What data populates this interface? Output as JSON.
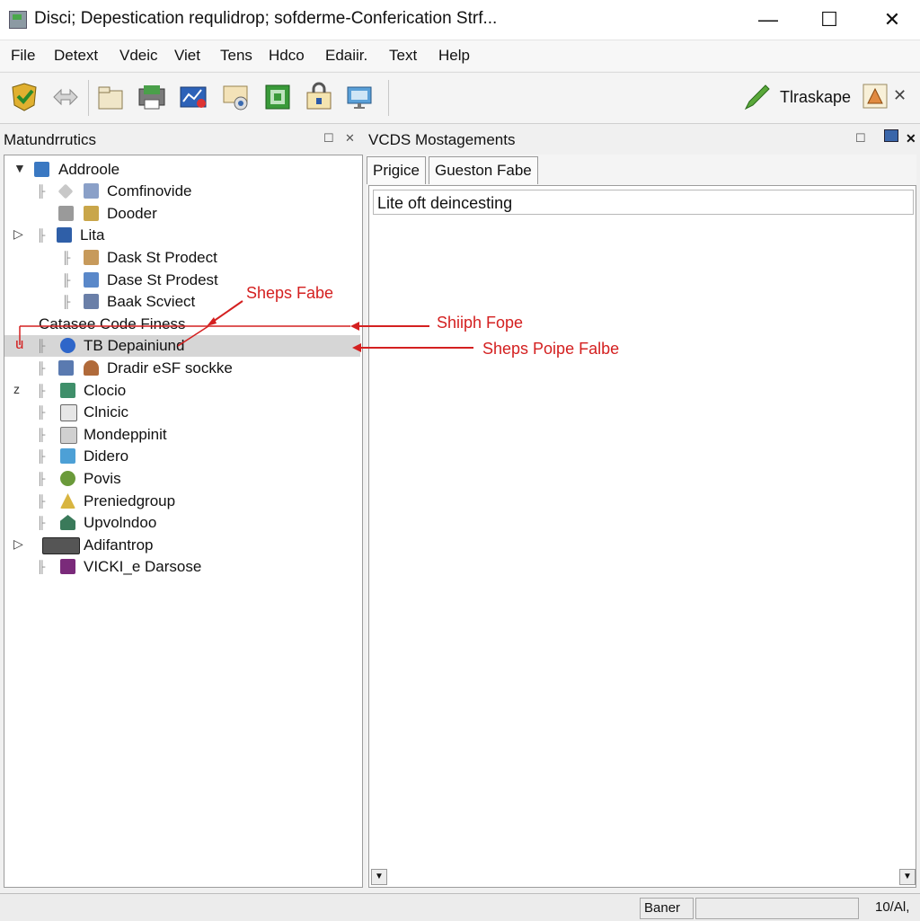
{
  "window": {
    "title": "Disci; Depestication requlidrop; sofderme-Conferication Strf...",
    "minimize_glyph": "—",
    "maximize_glyph": "☐",
    "close_glyph": "✕"
  },
  "menu": [
    "File",
    "Detext",
    "Vdeic",
    "Viet",
    "Tens",
    "Hdco",
    "Edaiir.",
    "Text",
    "Help"
  ],
  "toolbar": {
    "buttons": [
      "shield-icon",
      "arrows-icon",
      "folder-icon",
      "printer-icon",
      "chart-icon",
      "settings-icon",
      "grid-icon",
      "lock-icon",
      "monitor-icon"
    ],
    "right_label": "Tlraskape",
    "right_close_glyph": "✕"
  },
  "left_pane": {
    "title": "Matundrrutics",
    "pin_glyph": "☐",
    "close_glyph": "✕"
  },
  "right_pane": {
    "title": "VCDS Mostagements",
    "pin_glyph": "☐",
    "close_glyph": "✕"
  },
  "tabs": [
    "Prigice",
    "Gueston Fabe"
  ],
  "field_text": "Lite oft deincesting",
  "tree": [
    {
      "label": "Addroole",
      "expander": "▼",
      "icon_color": "#3a78c2",
      "selected": false
    },
    {
      "label": "Comfinovide",
      "expander": "",
      "icon_color": "#8aa0c8",
      "selected": false
    },
    {
      "label": "Dooder",
      "expander": "",
      "icon_color": "#c9a64a",
      "selected": false
    },
    {
      "label": "Lita",
      "expander": "▷",
      "icon_color": "#2f5fa8",
      "selected": false
    },
    {
      "label": "Dask St Prodect",
      "expander": "",
      "icon_color": "#c79a5b",
      "selected": false
    },
    {
      "label": "Dase St Prodest",
      "expander": "",
      "icon_color": "#5a88c9",
      "selected": false
    },
    {
      "label": "Baak Scviect",
      "expander": "",
      "icon_color": "#6a7fa8",
      "selected": false
    },
    {
      "label": "Catasee Code Finess",
      "expander": "",
      "icon_color": "",
      "selected": false
    },
    {
      "label": "TB Depainiund",
      "expander": "",
      "icon_color": "#2e66c9",
      "selected": true
    },
    {
      "label": "Dradir eSF sockke",
      "expander": "",
      "icon_color": "#b06a3a",
      "selected": false
    },
    {
      "label": "Clocio",
      "expander": "z",
      "icon_color": "#3f8f6a",
      "selected": false
    },
    {
      "label": "Clnicic",
      "expander": "",
      "icon_color": "#9a9a9a",
      "selected": false
    },
    {
      "label": "Mondeppinit",
      "expander": "",
      "icon_color": "#b8b8b8",
      "selected": false
    },
    {
      "label": "Didero",
      "expander": "",
      "icon_color": "#4da0d6",
      "selected": false
    },
    {
      "label": "Povis",
      "expander": "",
      "icon_color": "#6a9a3a",
      "selected": false
    },
    {
      "label": "Preniedgroup",
      "expander": "",
      "icon_color": "#d8b540",
      "selected": false
    },
    {
      "label": "Upvolndoo",
      "expander": "",
      "icon_color": "#3a7a5a",
      "selected": false
    },
    {
      "label": "Adifantrop",
      "expander": "▷",
      "icon_color": "#555555",
      "selected": false
    },
    {
      "label": "VICKI_e Darsose",
      "expander": "",
      "icon_color": "#7a2a7a",
      "selected": false
    }
  ],
  "annotations": [
    {
      "text": "Sheps Fabe"
    },
    {
      "text": "Shiiph Fope"
    },
    {
      "text": "Sheps Poipe Falbe"
    }
  ],
  "status": {
    "left_marker": "u",
    "label": "Baner",
    "right": "10/Al,"
  },
  "colors": {
    "annotation": "#d42020",
    "selection": "#d6d6d6"
  }
}
